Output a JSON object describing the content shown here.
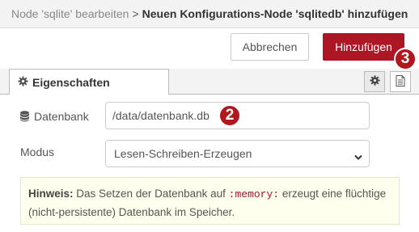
{
  "header": {
    "crumb_parent": "Node 'sqlite' bearbeiten",
    "crumb_separator": ">",
    "crumb_current": "Neuen Konfigurations-Node 'sqlitedb' hinzufügen"
  },
  "toolbar": {
    "cancel_label": "Abbrechen",
    "add_label": "Hinzufügen"
  },
  "badges": {
    "add_step": "3",
    "db_step": "2"
  },
  "tabs": {
    "properties_label": "Eigenschaften",
    "settings_icon": "gear-icon",
    "description_icon": "document-icon"
  },
  "form": {
    "database_label": "Datenbank",
    "database_icon": "database-icon",
    "database_value": "/data/datenbank.db",
    "mode_label": "Modus",
    "mode_value": "Lesen-Schreiben-Erzeugen"
  },
  "hint": {
    "title": "Hinweis:",
    "text_before": "Das Setzen der Datenbank auf",
    "code": ":memory:",
    "text_after": "erzeugt eine flüchtige (nicht-persistente) Datenbank im Speicher."
  },
  "colors": {
    "accent": "#ad1625",
    "badge": "#b1171e",
    "hint_background": "#ffffee"
  }
}
